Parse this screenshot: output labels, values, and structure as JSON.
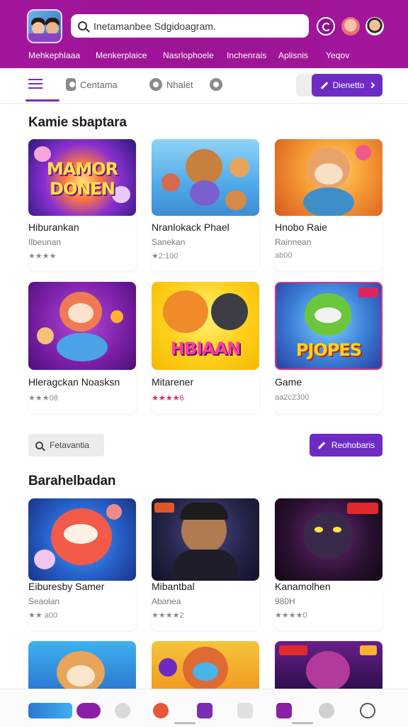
{
  "header": {
    "search_placeholder": "Inetamanbee Sdgidoagram.",
    "topnav": [
      "Mehkephlaaa",
      "Menkerplaice",
      "Nasrlophoele",
      "Inchenrais",
      "Aplisnis",
      "Yeqov"
    ]
  },
  "subnav": {
    "items": [
      "Centama",
      "Nhalet"
    ],
    "primary_button": "Dienetto"
  },
  "sections": [
    {
      "title": "Kamie sbaptara",
      "cards": [
        {
          "title": "Hiburankan",
          "sub": "Ilbeunan",
          "stars": "★★★★",
          "thumb_text": "MAMOR DONEN"
        },
        {
          "title": "Nranlokack Phael",
          "sub": "Sanekan",
          "stars": "★2:100",
          "thumb_text": ""
        },
        {
          "title": "Hnobo Raie",
          "sub": "Rainnean",
          "stars": "ab00",
          "thumb_text": ""
        },
        {
          "title": "Hleragckan Noasksn",
          "sub": "",
          "stars": "★★★08",
          "thumb_text": ""
        },
        {
          "title": "Mitarener",
          "sub": "",
          "stars": "★★★★6",
          "thumb_text": "HBIAAN"
        },
        {
          "title": "Game",
          "sub": "",
          "stars": "aa2c2300",
          "thumb_text": "PJOPES"
        }
      ]
    },
    {
      "title": "Barahelbadan",
      "cards": [
        {
          "title": "Eiburesby Samer",
          "sub": "Seaolan",
          "stars": "★★ a00",
          "thumb_text": ""
        },
        {
          "title": "Mibantbal",
          "sub": "Abanea",
          "stars": "★★★★2",
          "thumb_text": ""
        },
        {
          "title": "Kanamolhen",
          "sub": "980H",
          "stars": "★★★★0",
          "thumb_text": ""
        }
      ]
    }
  ],
  "filter_button": "Fetavantia",
  "action_button": "Reohobaris",
  "colors": {
    "header": "#a3169c",
    "accent": "#6d2bc4"
  }
}
